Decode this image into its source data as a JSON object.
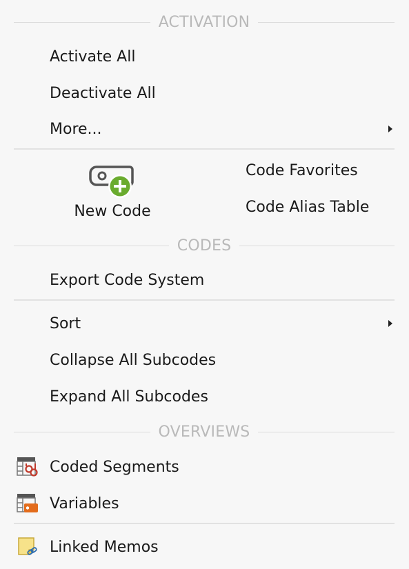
{
  "sections": {
    "activation": "ACTIVATION",
    "codes": "CODES",
    "overviews": "OVERVIEWS"
  },
  "activation": {
    "activate_all": "Activate All",
    "deactivate_all": "Deactivate All",
    "more": "More..."
  },
  "ribbon": {
    "new_code": "New Code",
    "code_favorites": "Code Favorites",
    "code_alias_table": "Code Alias Table"
  },
  "codes": {
    "export_code_system": "Export Code System",
    "sort": "Sort",
    "collapse_all": "Collapse All Subcodes",
    "expand_all": "Expand All Subcodes"
  },
  "overviews": {
    "coded_segments": "Coded Segments",
    "variables": "Variables",
    "linked_memos": "Linked Memos"
  },
  "icons": {
    "new_code": "tag-with-plus-icon",
    "coded_segments": "table-segments-icon",
    "variables": "table-variables-icon",
    "linked_memos": "memo-link-icon"
  },
  "colors": {
    "green_plus": "#6aab2e",
    "variable_orange": "#e36c1c",
    "memo_yellow": "#f7e28a",
    "segments_red": "#c0392b"
  }
}
